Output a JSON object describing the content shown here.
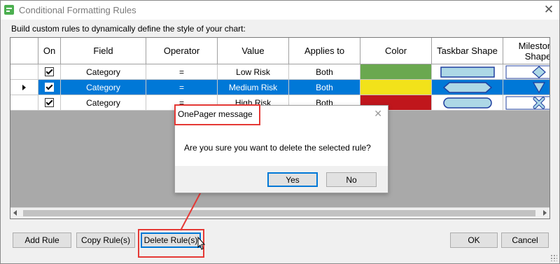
{
  "window": {
    "title": "Conditional Formatting Rules",
    "close_glyph": "✕"
  },
  "instruction": "Build custom rules to dynamically define the style of your chart:",
  "table": {
    "headers": [
      "On",
      "Field",
      "Operator",
      "Value",
      "Applies to",
      "Color",
      "Taskbar Shape",
      "Milestone Shape"
    ],
    "rows": [
      {
        "on": true,
        "field": "Category",
        "operator": "=",
        "value": "Low Risk",
        "applies_to": "Both",
        "color": "#6aa84f",
        "taskbar_shape": "rectangle",
        "milestone_shape": "diamond",
        "selected": false
      },
      {
        "on": true,
        "field": "Category",
        "operator": "=",
        "value": "Medium Risk",
        "applies_to": "Both",
        "color": "#f2e21a",
        "taskbar_shape": "hexagon",
        "milestone_shape": "triangle-down",
        "selected": true
      },
      {
        "on": true,
        "field": "Category",
        "operator": "=",
        "value": "High Risk",
        "applies_to": "Both",
        "color": "#c0161c",
        "taskbar_shape": "rounded",
        "milestone_shape": "x-cross",
        "selected": false
      }
    ]
  },
  "buttons": {
    "add_rule": "Add Rule",
    "copy_rule": "Copy Rule(s)",
    "delete_rule": "Delete Rule(s)",
    "ok": "OK",
    "cancel": "Cancel"
  },
  "message_box": {
    "title": "OnePager message",
    "close_glyph": "✕",
    "text": "Are you sure you want to delete the selected rule?",
    "yes": "Yes",
    "no": "No"
  },
  "colors": {
    "selection": "#0078d7",
    "annotation": "#e53935",
    "shape_fill": "#add8e6"
  },
  "icons": [
    "app-icon",
    "close-icon",
    "checkbox-icon",
    "row-selector-icon",
    "mouse-cursor-icon"
  ]
}
